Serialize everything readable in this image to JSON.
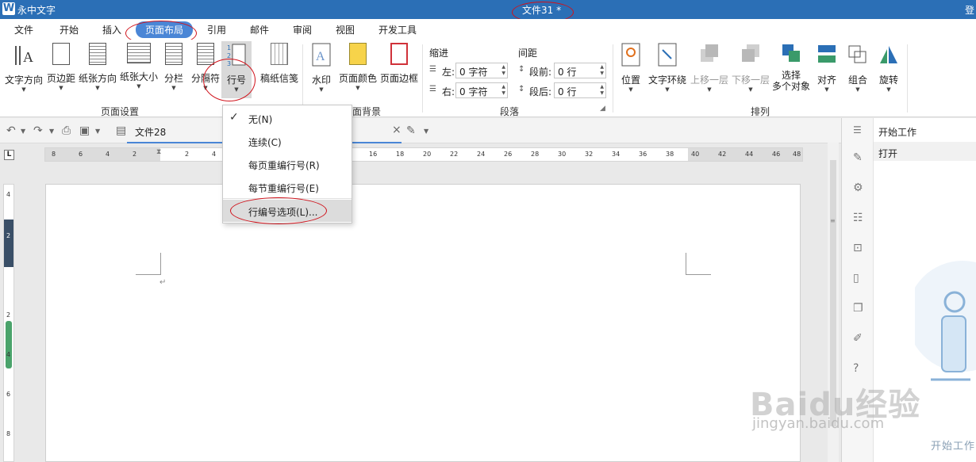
{
  "title_bar": {
    "logo": "W",
    "app_name": "永中文字",
    "document_title": "文件31 *",
    "login": "登"
  },
  "menu": {
    "tabs": [
      "文件",
      "开始",
      "插入",
      "页面布局",
      "引用",
      "邮件",
      "审阅",
      "视图",
      "开发工具"
    ],
    "active_tab": "页面布局"
  },
  "ribbon": {
    "page_setup": {
      "buttons": [
        "文字方向",
        "页边距",
        "纸张方向",
        "纸张大小",
        "分栏",
        "分隔符",
        "行号",
        "稿纸信笺"
      ],
      "group_label": "页面设置"
    },
    "page_background": {
      "buttons": [
        "水印",
        "页面颜色",
        "页面边框"
      ],
      "group_label": "面背景"
    },
    "paragraph": {
      "indent_label": "缩进",
      "spacing_label": "间距",
      "left_label": "左:",
      "left_value": "0 字符",
      "right_label": "右:",
      "right_value": "0 字符",
      "before_label": "段前:",
      "before_value": "0 行",
      "after_label": "段后:",
      "after_value": "0 行",
      "group_label": "段落"
    },
    "arrange": {
      "buttons": [
        "位置",
        "文字环绕",
        "上移一层",
        "下移一层",
        "选择多个对象",
        "对齐",
        "组合",
        "旋转"
      ],
      "group_label": "排列"
    }
  },
  "quickbar": {
    "doc_tab": "文件28"
  },
  "ruler": {
    "ticks": [
      "8",
      "6",
      "4",
      "2",
      "",
      "2",
      "4",
      "",
      "16",
      "18",
      "20",
      "22",
      "24",
      "26",
      "28",
      "30",
      "32",
      "34",
      "36",
      "38",
      "40",
      "42",
      "44",
      "46",
      "48"
    ],
    "vticks": [
      "4",
      "2",
      "2",
      "4",
      "6",
      "8"
    ]
  },
  "dropdown": {
    "items": [
      "无(N)",
      "连续(C)",
      "每页重编行号(R)",
      "每节重编行号(E)",
      "行编号选项(L)..."
    ],
    "checked_index": 0,
    "highlighted_index": 4
  },
  "task_pane": {
    "title": "开始工作",
    "open_item": "打开",
    "footer": "开始工作"
  },
  "watermark": {
    "main": "Baidu经验",
    "sub": "jingyan.baidu.com"
  },
  "colors": {
    "title_bar": "#2b6fb6",
    "active_tab": "#4a86d6",
    "annotation": "#d0121b"
  }
}
